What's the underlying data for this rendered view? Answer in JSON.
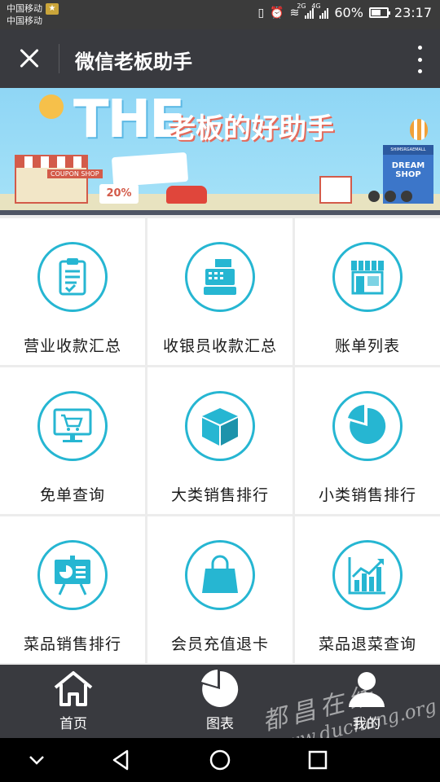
{
  "status_bar": {
    "carrier_1": "中国移动",
    "carrier_2": "中国移动",
    "network_1": "2G",
    "network_2": "4G",
    "battery": "60%",
    "time": "23:17"
  },
  "app_bar": {
    "title": "微信老板助手"
  },
  "banner": {
    "headline_en": "THE",
    "headline_cn": "老板的好助手",
    "coupon_shop": "COUPON SHOP",
    "discount": "20%",
    "dream_top": "SHIMSRGAEMALL",
    "dream_shop_1": "DREAM",
    "dream_shop_2": "SHOP",
    "page_count": 3,
    "active_page": 1
  },
  "grid": {
    "items": [
      {
        "label": "营业收款汇总",
        "icon": "clipboard-icon"
      },
      {
        "label": "收银员收款汇总",
        "icon": "cash-register-icon"
      },
      {
        "label": "账单列表",
        "icon": "storefront-icon"
      },
      {
        "label": "免单查询",
        "icon": "monitor-cart-icon"
      },
      {
        "label": "大类销售排行",
        "icon": "box-icon"
      },
      {
        "label": "小类销售排行",
        "icon": "pie-chart-icon"
      },
      {
        "label": "菜品销售排行",
        "icon": "presentation-board-icon"
      },
      {
        "label": "会员充值退卡",
        "icon": "shopping-bag-icon"
      },
      {
        "label": "菜品退菜查询",
        "icon": "line-chart-icon"
      }
    ],
    "accent_color": "#26b6d2"
  },
  "tab_bar": {
    "tabs": [
      {
        "label": "首页",
        "icon": "home-icon"
      },
      {
        "label": "图表",
        "icon": "pie-chart-icon"
      },
      {
        "label": "我的",
        "icon": "user-icon"
      }
    ]
  },
  "watermark": {
    "cn": "都昌在线",
    "url": "www.duchang.org"
  }
}
